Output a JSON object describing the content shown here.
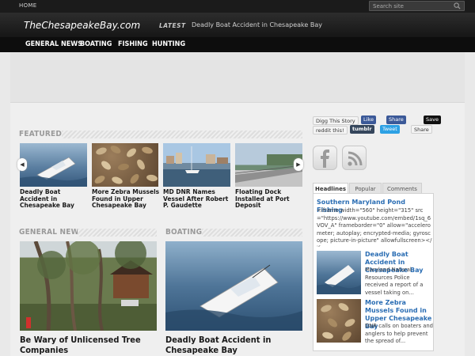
{
  "topbar": {
    "home_label": "HOME",
    "search_placeholder": "Search site"
  },
  "header": {
    "logo": "TheChesapeakeBay.com",
    "latest_tag": "LATEST",
    "latest_headline": "Deadly Boat Accident in Chesapeake Bay"
  },
  "nav": {
    "items": [
      "GENERAL NEWS",
      "BOATING",
      "FISHING",
      "HUNTING"
    ]
  },
  "featured": {
    "heading": "FEATURED",
    "items": [
      {
        "caption": "Deadly Boat Accident in Chesapeake Bay"
      },
      {
        "caption": "More Zebra Mussels Found in Upper Chesapeake Bay"
      },
      {
        "caption": "MD DNR Names Vessel After Robert P. Gaudette"
      },
      {
        "caption": "Floating Dock Installed at Port Deposit"
      }
    ]
  },
  "general_news": {
    "heading": "GENERAL NEWS",
    "caption": "Be Wary of Unlicensed Tree Companies"
  },
  "boating": {
    "heading": "BOATING",
    "caption": "Deadly Boat Accident in Chesapeake Bay"
  },
  "social": {
    "digg": "Digg This Story",
    "like": "Like",
    "fb_share": "Share",
    "save": "Save",
    "reddit": "reddit this!",
    "tumblr": "tumblr",
    "tweet": "Tweet",
    "vk_share": "Share"
  },
  "sidebar": {
    "tabs": [
      "Headlines",
      "Popular",
      "Comments"
    ],
    "active_tab": "Headlines",
    "top_story": {
      "title": "Southern Maryland Pond Fishing",
      "excerpt": "<iframe width=\"560\" height=\"315\" src=\"https://www.youtube.com/embed/1sq_6VOV_A\" frameborder=\"0\" allow=\"accelerometer; autoplay; encrypted-media; gyroscope; picture-in-picture\" allowfullscreen></iframe>"
    },
    "stories": [
      {
        "title": "Deadly Boat Accident in Chesapeake Bay",
        "excerpt": "Maryland Natural Resources Police received a report of a vessel taking on..."
      },
      {
        "title": "More Zebra Mussels Found in Upper Chesapeake Bay",
        "excerpt": "DNR calls on boaters and anglers to help prevent the spread of..."
      }
    ]
  },
  "colors": {
    "link": "#2a6db3",
    "nav_bg": "#0d0d0d",
    "header_bg": "#1f1f1f"
  }
}
